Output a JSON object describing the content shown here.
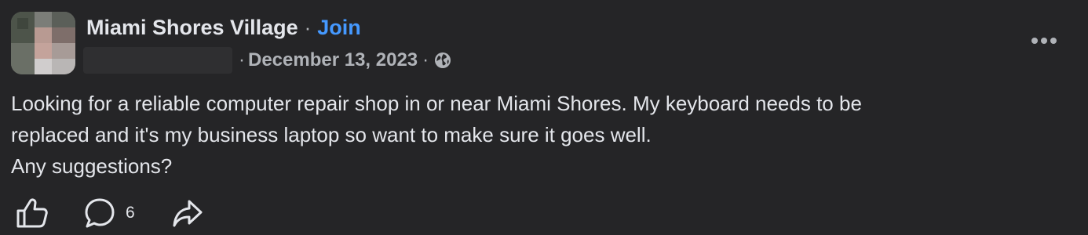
{
  "post": {
    "group_name": "Miami Shores Village",
    "separator": "·",
    "join_label": "Join",
    "date": "December 13, 2023",
    "audience_icon": "globe-icon",
    "body_lines": [
      "Looking for a reliable computer repair shop in or near Miami Shores. My keyboard needs to be",
      "replaced and it's my business laptop so want to make sure it goes well.",
      "Any suggestions?"
    ]
  },
  "actions": {
    "like_icon": "thumbs-up-icon",
    "comment_icon": "comment-bubble-icon",
    "comment_count": "6",
    "share_icon": "share-arrow-icon"
  },
  "colors": {
    "background": "#252527",
    "text_primary": "#e4e6eb",
    "text_secondary": "#b0b3b8",
    "link": "#4599ff"
  }
}
